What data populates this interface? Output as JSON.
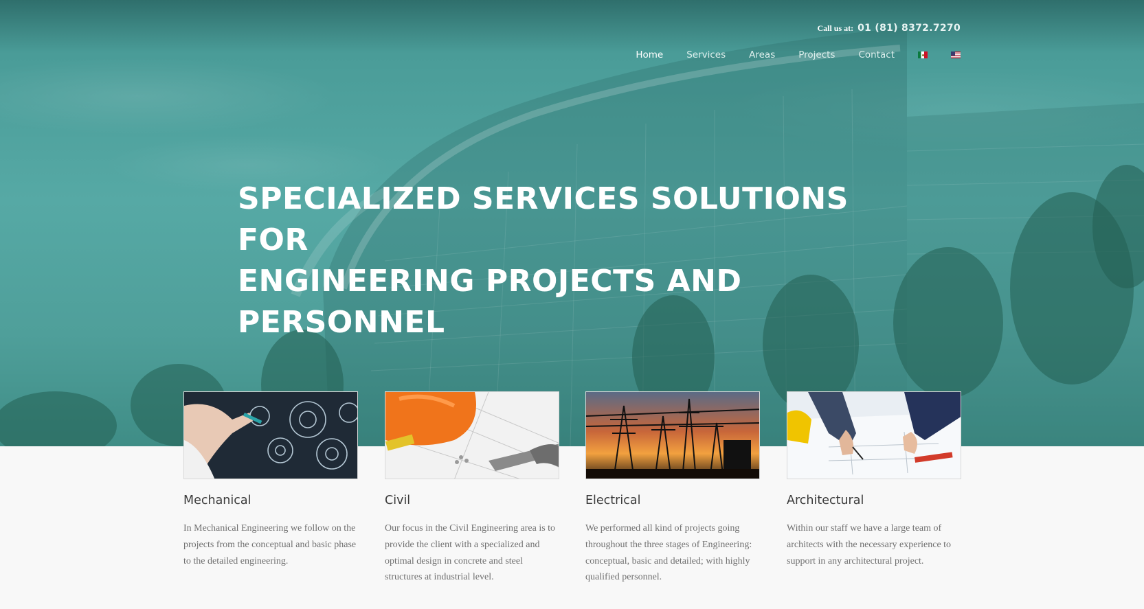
{
  "header": {
    "call_label": "Call us at:",
    "phone": "01 (81) 8372.7270",
    "nav": [
      {
        "label": "Home",
        "active": true
      },
      {
        "label": "Services",
        "active": false
      },
      {
        "label": "Areas",
        "active": false
      },
      {
        "label": "Projects",
        "active": false
      },
      {
        "label": "Contact",
        "active": false
      }
    ],
    "languages": [
      "mexico-flag-icon",
      "usa-flag-icon"
    ]
  },
  "hero": {
    "headline_line1": "SPECIALIZED SERVICES SOLUTIONS FOR",
    "headline_line2": "ENGINEERING PROJECTS AND PERSONNEL",
    "overlay_color": "#4fa8a3"
  },
  "cards": [
    {
      "title": "Mechanical",
      "image": "hand-drawing-gears-icon",
      "line1": "In Mechanical Engineering we follow on the",
      "line2": "projects from the conceptual and basic phase",
      "line3": "to the detailed engineering.",
      "line4": ""
    },
    {
      "title": "Civil",
      "image": "hard-hat-and-tools-icon",
      "line1": "Our focus in the Civil Engineering area is to",
      "line2": "provide the client with a specialized and",
      "line3": "optimal design in concrete and steel",
      "line4": "structures at industrial level."
    },
    {
      "title": "Electrical",
      "image": "power-towers-sunset-icon",
      "line1": "We performed all kind of projects going",
      "line2": "throughout the three stages of Engineering:",
      "line3": "conceptual, basic and detailed; with highly",
      "line4": "qualified personnel."
    },
    {
      "title": "Architectural",
      "image": "blueprint-hands-icon",
      "line1": "Within our staff we have a large team of",
      "line2": "architects with the necessary experience to",
      "line3": "support in any architectural project.",
      "line4": ""
    }
  ]
}
